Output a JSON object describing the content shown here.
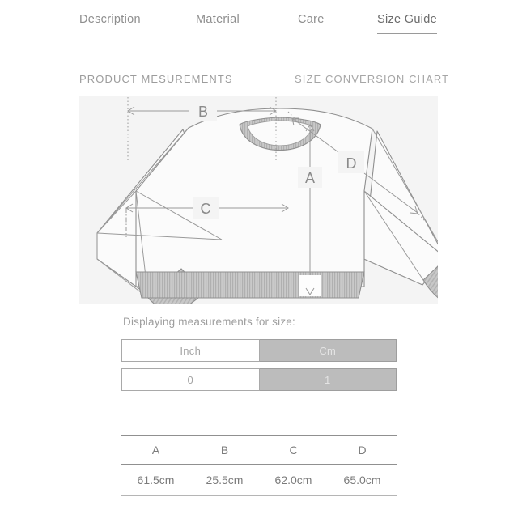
{
  "tabs": [
    {
      "label": "Description",
      "active": false
    },
    {
      "label": "Material",
      "active": false
    },
    {
      "label": "Care",
      "active": false
    },
    {
      "label": "Size Guide",
      "active": true
    }
  ],
  "sections": {
    "left": "PRODUCT MESUREMENTS",
    "right": "SIZE CONVERSION CHART"
  },
  "diagram": {
    "name": "sweatshirt-measurement-diagram",
    "markers": {
      "a": "A",
      "b": "B",
      "c": "C",
      "d": "D"
    }
  },
  "selector": {
    "label": "Displaying measurements for size:",
    "units": [
      {
        "label": "Inch",
        "selected": false
      },
      {
        "label": "Cm",
        "selected": true
      }
    ],
    "sizes": [
      {
        "label": "0",
        "selected": false
      },
      {
        "label": "1",
        "selected": true
      }
    ]
  },
  "measurements": {
    "headers": [
      "A",
      "B",
      "C",
      "D"
    ],
    "values": [
      "61.5cm",
      "25.5cm",
      "62.0cm",
      "65.0cm"
    ]
  },
  "colors": {
    "page_bg": "#ffffff",
    "panel_bg": "#f4f4f4",
    "selected_cell": "#bcbcbc",
    "text": "#8a8a8a",
    "rule": "#909090"
  }
}
